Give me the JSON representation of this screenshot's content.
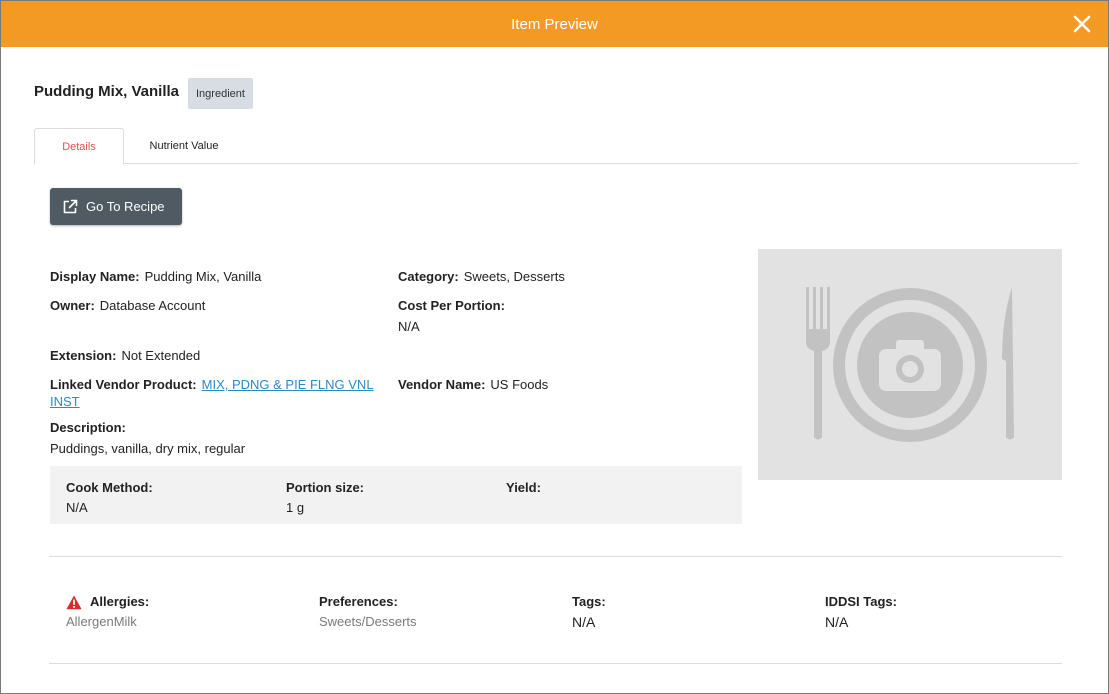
{
  "modal": {
    "title": "Item Preview"
  },
  "item": {
    "name": "Pudding Mix, Vanilla",
    "type_badge": "Ingredient"
  },
  "tabs": [
    {
      "label": "Details",
      "active": true
    },
    {
      "label": "Nutrient Value",
      "active": false
    }
  ],
  "actions": {
    "go_to_recipe": "Go To Recipe"
  },
  "details": {
    "display_name": {
      "label": "Display Name:",
      "value": "Pudding Mix, Vanilla"
    },
    "category": {
      "label": "Category:",
      "value": "Sweets, Desserts"
    },
    "owner": {
      "label": "Owner:",
      "value": "Database Account"
    },
    "cost_per_portion": {
      "label": "Cost Per Portion:",
      "value": "N/A"
    },
    "extension": {
      "label": "Extension:",
      "value": "Not Extended"
    },
    "linked_vendor_product": {
      "label": "Linked Vendor Product:",
      "value_line1": "MIX, PDNG & PIE FLNG VNL",
      "value_line2": "INST"
    },
    "vendor_name": {
      "label": "Vendor Name:",
      "value": "US Foods"
    },
    "description": {
      "label": "Description:",
      "value": "Puddings, vanilla, dry mix, regular"
    }
  },
  "cook": {
    "method": {
      "label": "Cook Method:",
      "value": "N/A"
    },
    "portion_size": {
      "label": "Portion size:",
      "value": "1 g"
    },
    "yield": {
      "label": "Yield:",
      "value": ""
    }
  },
  "tags_section": {
    "allergies": {
      "label": "Allergies:",
      "value": "AllergenMilk"
    },
    "preferences": {
      "label": "Preferences:",
      "value": "Sweets/Desserts"
    },
    "tags": {
      "label": "Tags:",
      "value": "N/A"
    },
    "iddsi_tags": {
      "label": "IDDSI Tags:",
      "value": "N/A"
    }
  },
  "colors": {
    "header": "#f39a24",
    "active_tab": "#d9534f",
    "button": "#4f5a63",
    "link": "#2a8bc5",
    "warning": "#d62c2c"
  },
  "icons": {
    "close": "close-icon",
    "external_link": "external-link-icon",
    "photo_placeholder": "plate-camera-icon",
    "warning": "warning-icon"
  }
}
